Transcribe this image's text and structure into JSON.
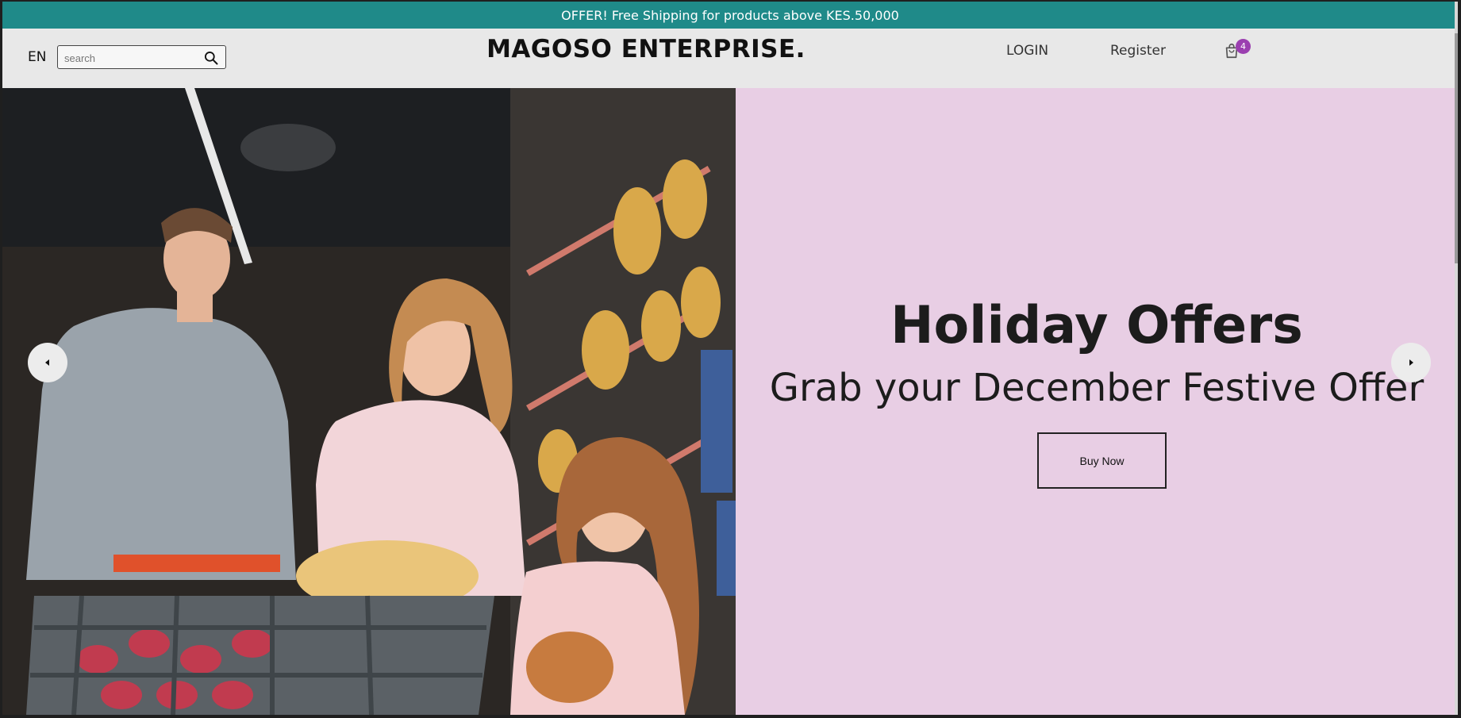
{
  "announcement": {
    "text": "OFFER! Free Shipping for products above KES.50,000",
    "background": "#1f8a89"
  },
  "header": {
    "language": "EN",
    "search": {
      "placeholder": "search",
      "value": ""
    },
    "logo": "MAGOSO ENTERPRISE.",
    "login_label": "LOGIN",
    "register_label": "Register",
    "cart_count": "4",
    "badge_color": "#9b3fb0"
  },
  "hero": {
    "title": "Holiday Offers",
    "subtitle": "Grab your December Festive Offer",
    "cta_label": "Buy Now",
    "panel_color": "#e8cee4",
    "image_subject": "family-shopping-supermarket"
  },
  "icons": {
    "search": "search-icon",
    "cart": "shopping-bag-icon",
    "prev": "chevron-left-icon",
    "next": "chevron-right-icon"
  }
}
